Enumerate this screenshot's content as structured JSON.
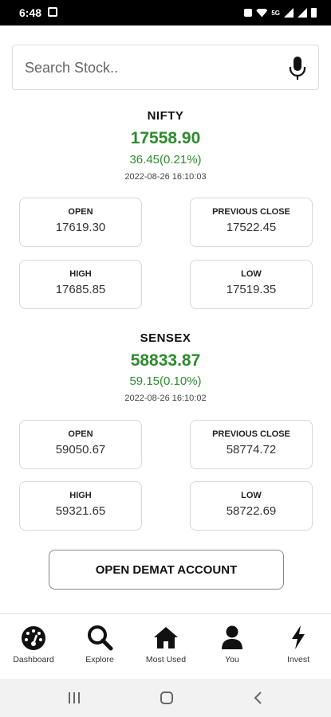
{
  "status_bar": {
    "time": "6:48",
    "right_text": "5G"
  },
  "search": {
    "placeholder": "Search Stock.."
  },
  "indices": [
    {
      "name": "NIFTY",
      "value": "17558.90",
      "change": "36.45(0.21%)",
      "timestamp": "2022-08-26 16:10:03",
      "open_label": "OPEN",
      "open_value": "17619.30",
      "prev_close_label": "PREVIOUS CLOSE",
      "prev_close_value": "17522.45",
      "high_label": "HIGH",
      "high_value": "17685.85",
      "low_label": "LOW",
      "low_value": "17519.35"
    },
    {
      "name": "SENSEX",
      "value": "58833.87",
      "change": "59.15(0.10%)",
      "timestamp": "2022-08-26 16:10:02",
      "open_label": "OPEN",
      "open_value": "59050.67",
      "prev_close_label": "PREVIOUS CLOSE",
      "prev_close_value": "58774.72",
      "high_label": "HIGH",
      "high_value": "59321.65",
      "low_label": "LOW",
      "low_value": "58722.69"
    }
  ],
  "demat_button": {
    "label": "OPEN DEMAT ACCOUNT"
  },
  "bottom_nav": [
    {
      "label": "Dashboard",
      "icon": "dashboard-gauge-icon"
    },
    {
      "label": "Explore",
      "icon": "search-icon"
    },
    {
      "label": "Most Used",
      "icon": "home-icon"
    },
    {
      "label": "You",
      "icon": "user-icon"
    },
    {
      "label": "Invest",
      "icon": "lightning-icon"
    }
  ],
  "colors": {
    "positive": "#2e8b2e",
    "border": "#d8d8d8"
  }
}
